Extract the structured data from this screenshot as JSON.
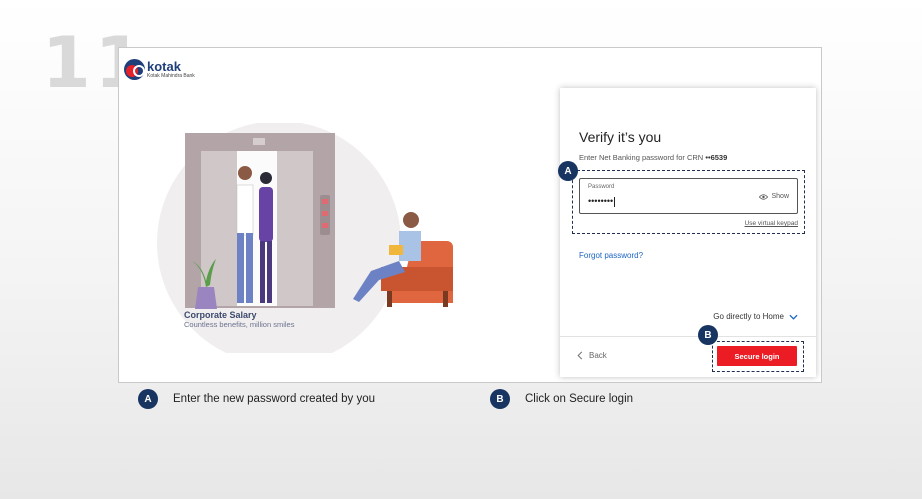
{
  "step_number": "11",
  "logo": {
    "name": "kotak",
    "subtitle": "Kotak Mahindra Bank"
  },
  "illustration": {
    "caption_title": "Corporate Salary",
    "caption_subtitle": "Countless benefits, million smiles"
  },
  "login_card": {
    "title": "Verify it’s you",
    "subtitle_prefix": "Enter Net Banking password for CRN ",
    "crn_masked": "••6539",
    "password_label": "Password",
    "password_value": "••••••••",
    "show_label": "Show",
    "virtual_keypad_link": "Use virtual keypad",
    "forgot_password_link": "Forgot password?",
    "go_home_label": "Go directly to Home",
    "back_label": "Back",
    "secure_login_label": "Secure login"
  },
  "markers": {
    "a": "A",
    "b": "B"
  },
  "legend": [
    {
      "marker": "A",
      "text": "Enter the new password created by you"
    },
    {
      "marker": "B",
      "text": "Click on Secure login"
    }
  ],
  "colors": {
    "brand_blue": "#1f3f7a",
    "brand_red": "#ec1c24",
    "link_blue": "#1c64c4",
    "marker_navy": "#183461"
  }
}
